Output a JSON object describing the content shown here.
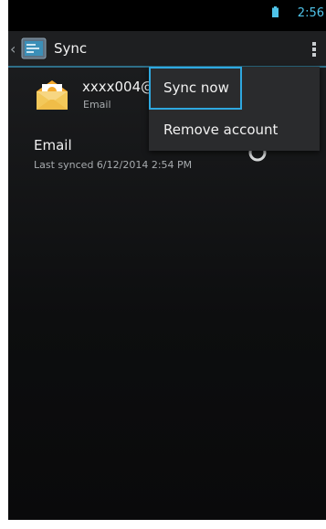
{
  "status_bar": {
    "time": "2:56",
    "icons": [
      "battery-icon"
    ]
  },
  "action_bar": {
    "back_icon": "chevron-left-icon",
    "app_icon": "settings-app-icon",
    "title": "Sync",
    "overflow_icon": "overflow-menu-icon"
  },
  "account": {
    "name": "xxxx004@",
    "type": "Email",
    "icon": "envelope-icon"
  },
  "sync_items": [
    {
      "title": "Email",
      "subtitle": "Last synced 6/12/2014 2:54 PM",
      "icon": "sync-icon"
    }
  ],
  "overflow_menu": {
    "items": [
      {
        "label": "Sync now",
        "highlighted": true
      },
      {
        "label": "Remove account",
        "highlighted": false
      }
    ]
  },
  "colors": {
    "accent": "#2fa8e0",
    "clock": "#4fc3e9",
    "background": "#0b0b0c",
    "menu_background": "#2a2b2d",
    "primary_text": "#f1f1f1",
    "secondary_text": "#a7abae"
  }
}
